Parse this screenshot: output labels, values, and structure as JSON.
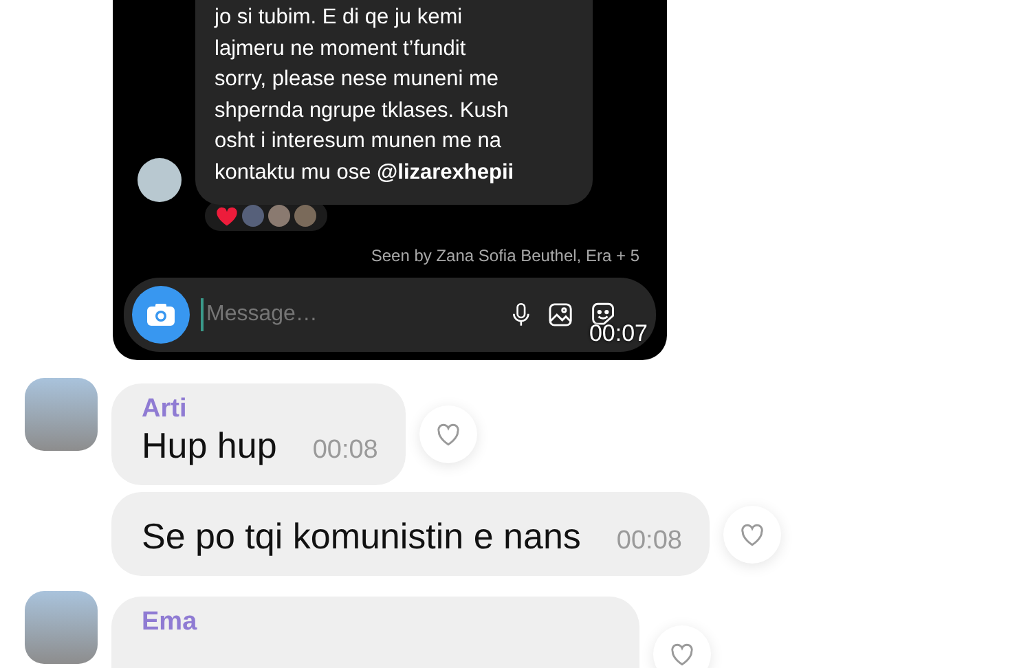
{
  "shared_screenshot": {
    "message": "jo si tubim. E di qe ju kemi\nlajmeru ne moment t’fundit\nsorry, please nese muneni me\nshpernda ngrupe tklases. Kush\nosht i interesum munen me na\nkontaktu mu ose **@lizarexhepii**",
    "reactions": [
      {
        "kind": "heart"
      },
      {
        "kind": "avatar"
      },
      {
        "kind": "avatar"
      },
      {
        "kind": "avatar"
      }
    ],
    "seen_by": "Seen by Zana Sofia Beuthel, Era + 5",
    "composer": {
      "placeholder": "Message…"
    },
    "overlay_time": "00:07"
  },
  "messages": [
    {
      "sender": "Arti",
      "text": "Hup hup",
      "time": "00:08"
    },
    {
      "text": "Se po tqi komunistin e nans",
      "time": "00:08"
    },
    {
      "sender": "Ema"
    }
  ]
}
